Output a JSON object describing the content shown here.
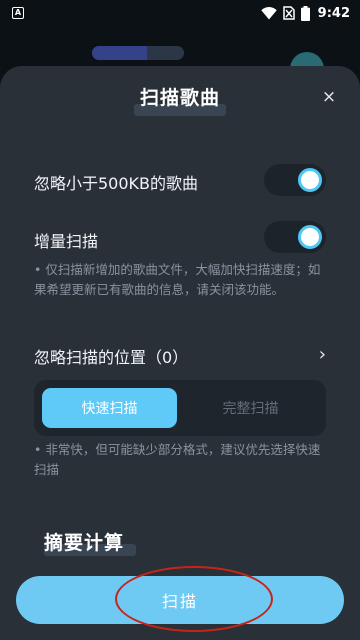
{
  "status_bar": {
    "time": "9:42",
    "notif_icon_letter": "A",
    "icons": [
      "app-notification-icon",
      "wifi-icon",
      "no-sim-icon",
      "battery-icon"
    ]
  },
  "sheet": {
    "title": "扫描歌曲",
    "close_label": "×"
  },
  "settings": {
    "ignore_small": {
      "label": "忽略小于500KB的歌曲",
      "enabled": true
    },
    "incremental": {
      "label": "增量扫描",
      "enabled": true
    },
    "incremental_hint": "• 仅扫描新增加的歌曲文件，大幅加快扫描速度；如果希望更新已有歌曲的信息，请关闭该功能。",
    "ignore_locations": {
      "label": "忽略扫描的位置（0）",
      "chevron": "›"
    },
    "scan_mode": {
      "options": [
        "快速扫描",
        "完整扫描"
      ],
      "selected": "快速扫描"
    },
    "scan_mode_hint": "• 非常快，但可能缺少部分格式，建议优先选择快速扫描"
  },
  "section": {
    "title": "摘要计算"
  },
  "primary_button": {
    "label": "扫描"
  },
  "colors": {
    "accent": "#5fc9f8",
    "sheet_bg": "#293038",
    "annotation": "#c8231a"
  }
}
